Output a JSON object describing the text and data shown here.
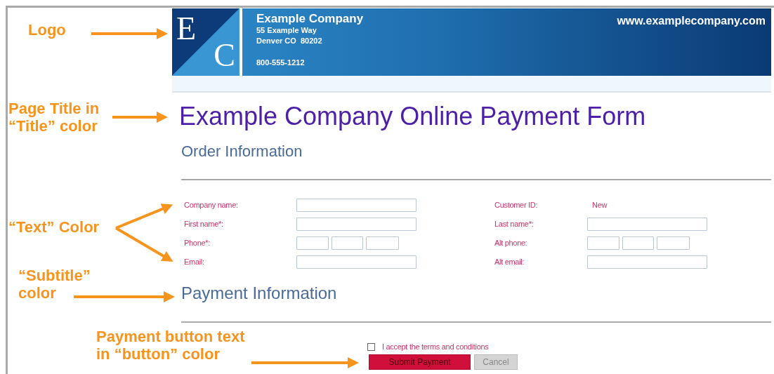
{
  "header": {
    "logo_letters": [
      "E",
      "C"
    ],
    "company": "Example Company",
    "address_lines": [
      "55 Example Way",
      "Denver CO  80202"
    ],
    "phone": "800-555-1212",
    "website": "www.examplecompany.com"
  },
  "page_title": "Example Company Online Payment Form",
  "order_section": {
    "title": "Order Information",
    "rows": [
      {
        "left": {
          "label": "Company name:",
          "kind": "input"
        },
        "right": {
          "label": "Customer ID:",
          "kind": "value",
          "value": "New"
        }
      },
      {
        "left": {
          "label": "First name*:",
          "kind": "input"
        },
        "right": {
          "label": "Last name*:",
          "kind": "input"
        }
      },
      {
        "left": {
          "label": "Phone*:",
          "kind": "phone"
        },
        "right": {
          "label": "Alt phone:",
          "kind": "phone"
        }
      },
      {
        "left": {
          "label": "Email:",
          "kind": "input"
        },
        "right": {
          "label": "Alt email:",
          "kind": "input"
        }
      }
    ]
  },
  "payment_section": {
    "title": "Payment Information"
  },
  "terms": {
    "label": "I accept the terms and conditions",
    "checked": false
  },
  "buttons": [
    {
      "label": "Submit Payment",
      "kind": "primary"
    },
    {
      "label": "Cancel",
      "kind": "secondary"
    }
  ],
  "annotations": [
    {
      "text": "Logo"
    },
    {
      "text": "Page Title in\n“Title” color"
    },
    {
      "text": "“Text” Color"
    },
    {
      "text": "“Subtitle”\ncolor"
    },
    {
      "text": "Payment button text\nin “button” color"
    }
  ]
}
